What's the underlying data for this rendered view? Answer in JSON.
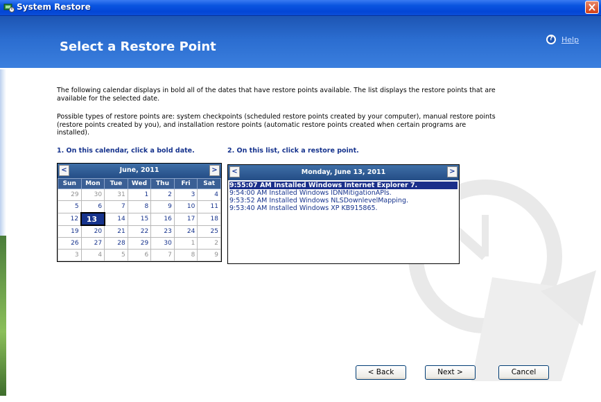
{
  "window": {
    "title": "System Restore"
  },
  "header": {
    "title": "Select a Restore Point",
    "help_label": "Help"
  },
  "body": {
    "paragraph1": "The following calendar displays in bold all of the dates that have restore points available. The list displays the restore points that are available for the selected date.",
    "paragraph2": "Possible types of restore points are: system checkpoints (scheduled restore points created by your computer), manual restore points (restore points created by you), and installation restore points (automatic restore points created when certain programs are installed).",
    "step1": "1. On this calendar, click a bold date.",
    "step2": "2. On this list, click a restore point."
  },
  "calendar": {
    "month": "June, 2011",
    "prev_label": "<",
    "next_label": ">",
    "weekdays": [
      "Sun",
      "Mon",
      "Tue",
      "Wed",
      "Thu",
      "Fri",
      "Sat"
    ],
    "weeks": [
      [
        "29",
        "30",
        "31",
        "1",
        "2",
        "3",
        "4"
      ],
      [
        "5",
        "6",
        "7",
        "8",
        "9",
        "10",
        "11"
      ],
      [
        "12",
        "13",
        "14",
        "15",
        "16",
        "17",
        "18"
      ],
      [
        "19",
        "20",
        "21",
        "22",
        "23",
        "24",
        "25"
      ],
      [
        "26",
        "27",
        "28",
        "29",
        "30",
        "1",
        "2"
      ],
      [
        "3",
        "4",
        "5",
        "6",
        "7",
        "8",
        "9"
      ]
    ],
    "selected_date": "13"
  },
  "restore_list": {
    "date": "Monday, June 13, 2011",
    "prev_label": "<",
    "next_label": ">",
    "items": [
      "9:55:07 AM  Installed Windows Internet Explorer 7.",
      "9:54:00 AM  Installed Windows IDNMitigationAPIs.",
      "9:53:52 AM  Installed Windows NLSDownlevelMapping.",
      "9:53:40 AM  Installed Windows XP KB915865."
    ]
  },
  "buttons": {
    "back": "< Back",
    "next": "Next >",
    "cancel": "Cancel"
  },
  "colors": {
    "accent": "#16338d",
    "header": "#2b6dd0",
    "selection": "#1a2f8a"
  }
}
